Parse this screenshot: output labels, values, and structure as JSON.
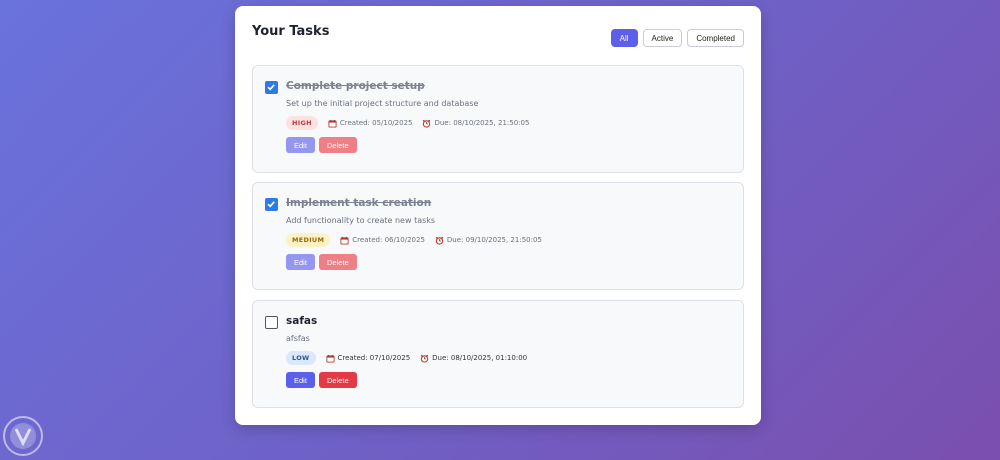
{
  "panel": {
    "title": "Your Tasks",
    "filters": [
      {
        "label": "All",
        "active": true
      },
      {
        "label": "Active",
        "active": false
      },
      {
        "label": "Completed",
        "active": false
      }
    ]
  },
  "tasks": [
    {
      "title": "Complete project setup",
      "description": "Set up the initial project structure and database",
      "priority": "HIGH",
      "created": "Created: 05/10/2025",
      "due": "Due: 08/10/2025, 21:50:05",
      "completed": true,
      "edit_label": "Edit",
      "delete_label": "Delete"
    },
    {
      "title": "Implement task creation",
      "description": "Add functionality to create new tasks",
      "priority": "MEDIUM",
      "created": "Created: 06/10/2025",
      "due": "Due: 09/10/2025, 21:50:05",
      "completed": true,
      "edit_label": "Edit",
      "delete_label": "Delete"
    },
    {
      "title": "safas",
      "description": "afsfas",
      "priority": "LOW",
      "created": "Created: 07/10/2025",
      "due": "Due: 08/10/2025, 01:10:00",
      "completed": false,
      "edit_label": "Edit",
      "delete_label": "Delete"
    }
  ],
  "icons": {
    "calendar": "calendar-icon",
    "alarm": "alarm-clock-icon",
    "check": "checkmark-icon"
  },
  "colors": {
    "accent": "#5b5fe9",
    "danger": "#e53945",
    "checkbox": "#2f7be5"
  }
}
